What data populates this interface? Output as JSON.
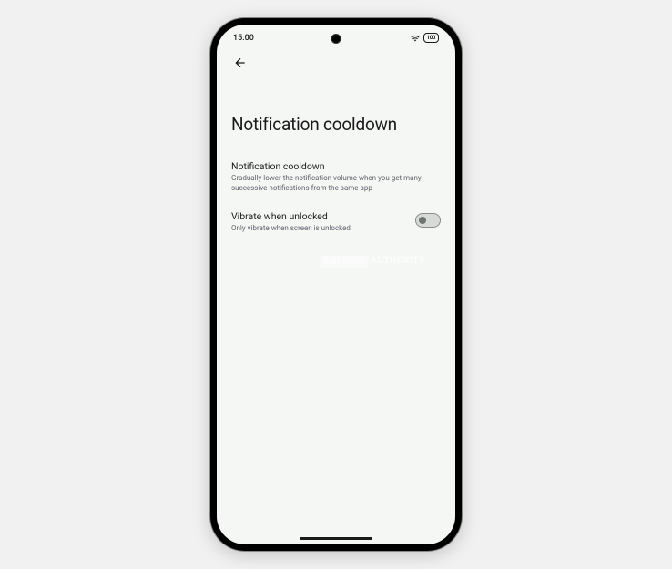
{
  "statusBar": {
    "time": "15:00",
    "battery": "100"
  },
  "header": {
    "pageTitle": "Notification cooldown"
  },
  "settings": [
    {
      "title": "Notification cooldown",
      "description": "Gradually lower the notification volume when you get many successive notifications from the same app"
    },
    {
      "title": "Vibrate when unlocked",
      "description": "Only vibrate when screen is unlocked"
    }
  ],
  "watermark": {
    "left": "ANDROID",
    "right": "AUTHORITY"
  }
}
